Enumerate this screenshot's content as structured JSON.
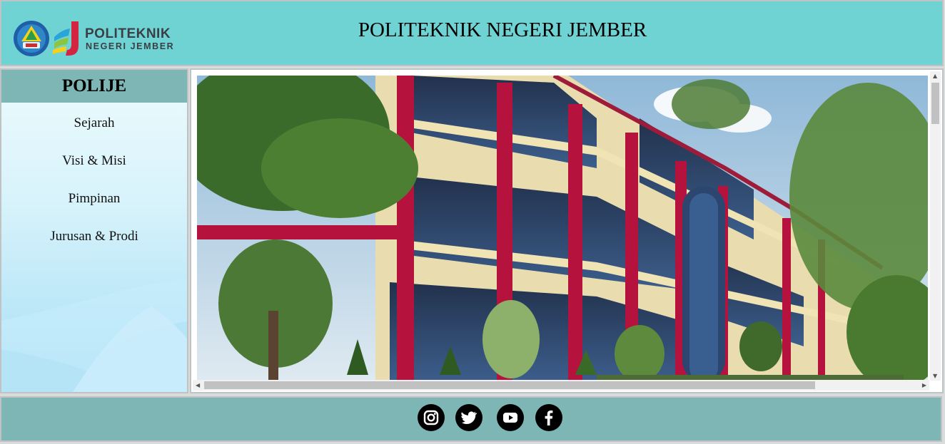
{
  "header": {
    "title": "POLITEKNIK NEGERI JEMBER",
    "logo_line1": "POLITEKNIK",
    "logo_line2": "NEGERI JEMBER"
  },
  "sidebar": {
    "heading": "POLIJE",
    "items": [
      {
        "label": "Sejarah"
      },
      {
        "label": "Visi & Misi"
      },
      {
        "label": "Pimpinan"
      },
      {
        "label": "Jurusan & Prodi"
      }
    ]
  },
  "main": {
    "image_icon": "campus-building-photo"
  },
  "footer": {
    "social": [
      {
        "icon": "instagram-icon"
      },
      {
        "icon": "twitter-icon"
      },
      {
        "icon": "youtube-icon"
      },
      {
        "icon": "facebook-icon"
      }
    ]
  },
  "colors": {
    "header_bg": "#6fd3d3",
    "sidebar_head_bg": "#7eb5b5",
    "footer_bg": "#7eb5b5",
    "building_accent": "#b5123d"
  }
}
